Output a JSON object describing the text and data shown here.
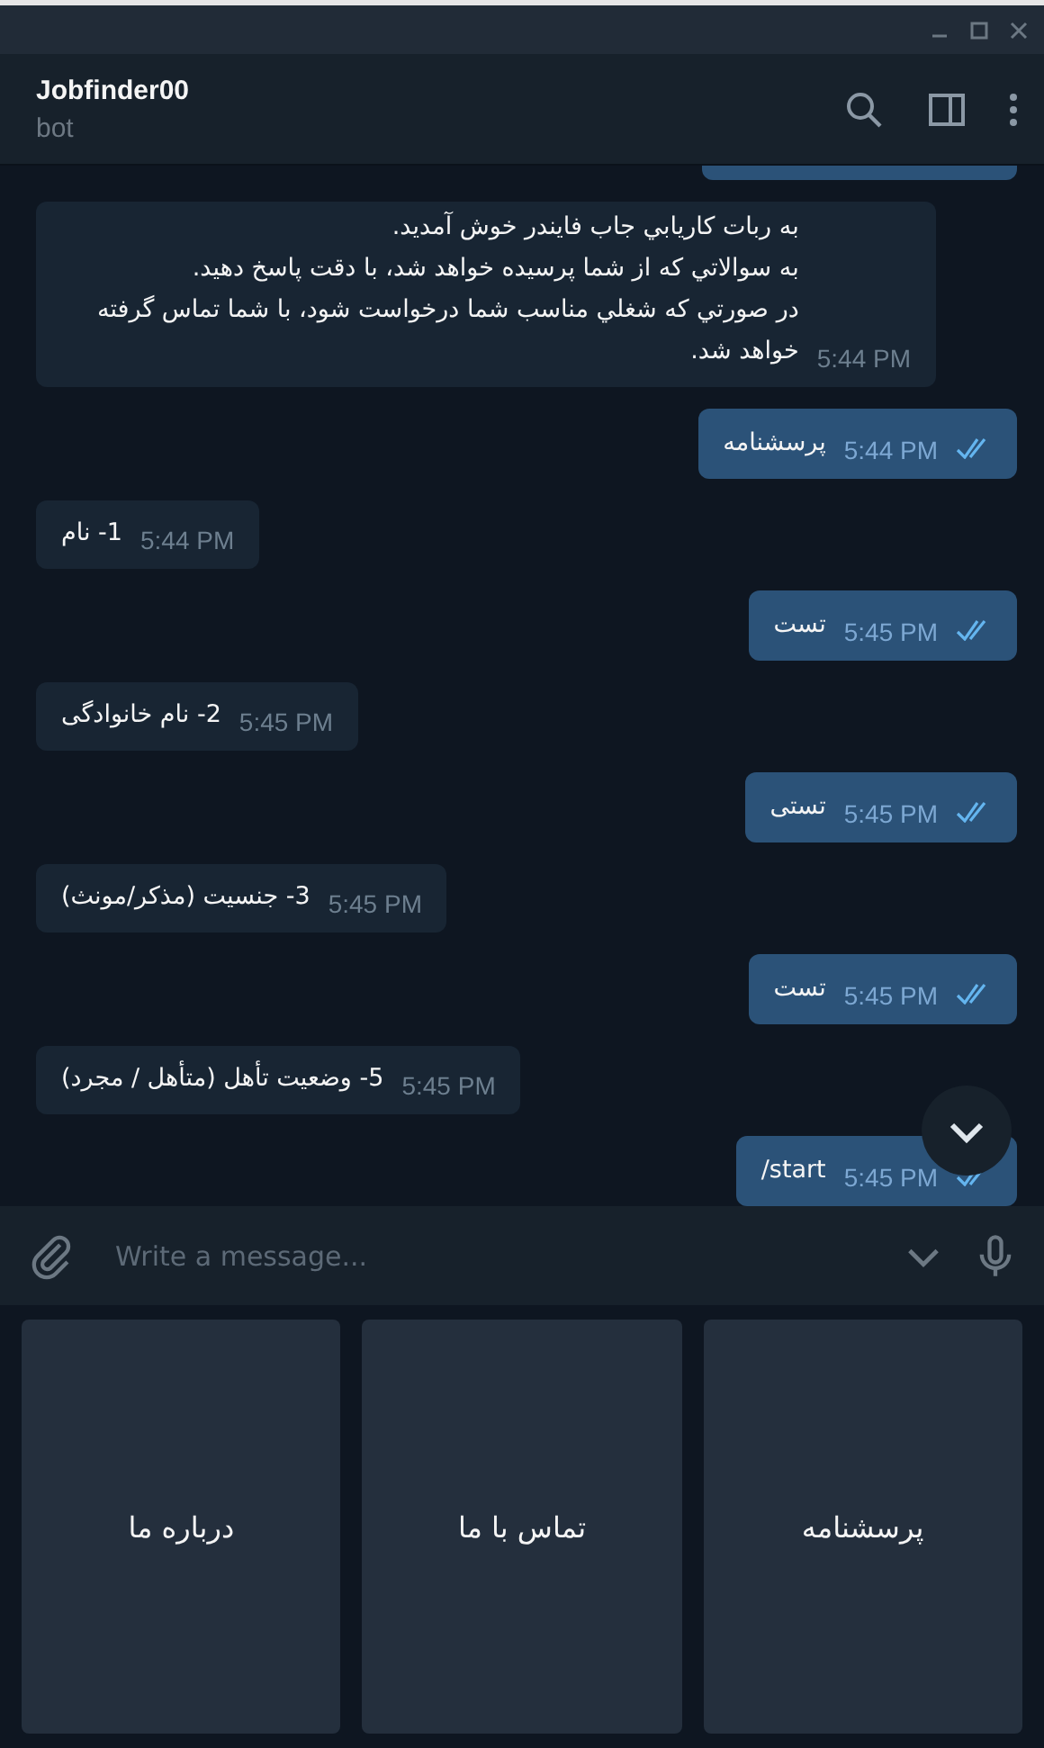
{
  "chat": {
    "title": "Jobfinder00",
    "subtitle": "bot"
  },
  "messages": [
    {
      "kind": "partial"
    },
    {
      "kind": "in",
      "text": "به ربات کاريابي جاب فايندر خوش آمديد.\nبه سوالاتي که از شما پرسيده خواهد شد، با دقت پاسخ دهيد.\nدر صورتي که شغلي مناسب شما درخواست شود، با شما تماس گرفته خواهد شد.",
      "time": "5:44 PM",
      "read": false
    },
    {
      "kind": "out",
      "text": "پرسشنامه",
      "time": "5:44 PM",
      "read": true
    },
    {
      "kind": "in",
      "text": "1- نام",
      "time": "5:44 PM",
      "read": false
    },
    {
      "kind": "out",
      "text": "تست",
      "time": "5:45 PM",
      "read": true
    },
    {
      "kind": "in",
      "text": "2- نام خانوادگی",
      "time": "5:45 PM",
      "read": false
    },
    {
      "kind": "out",
      "text": "تستی",
      "time": "5:45 PM",
      "read": true
    },
    {
      "kind": "in",
      "text": "3- جنسیت (مذکر/مونث)",
      "time": "5:45 PM",
      "read": false
    },
    {
      "kind": "out",
      "text": "تست",
      "time": "5:45 PM",
      "read": true
    },
    {
      "kind": "in",
      "text": "5- وضعیت تأهل (متأهل / مجرد)",
      "time": "5:45 PM",
      "read": false
    },
    {
      "kind": "out",
      "text": "/start",
      "time": "5:45 PM",
      "read": true
    }
  ],
  "composer": {
    "placeholder": "Write a message..."
  },
  "keyboard": [
    "پرسشنامه",
    "تماس با ما",
    "درباره ما"
  ]
}
